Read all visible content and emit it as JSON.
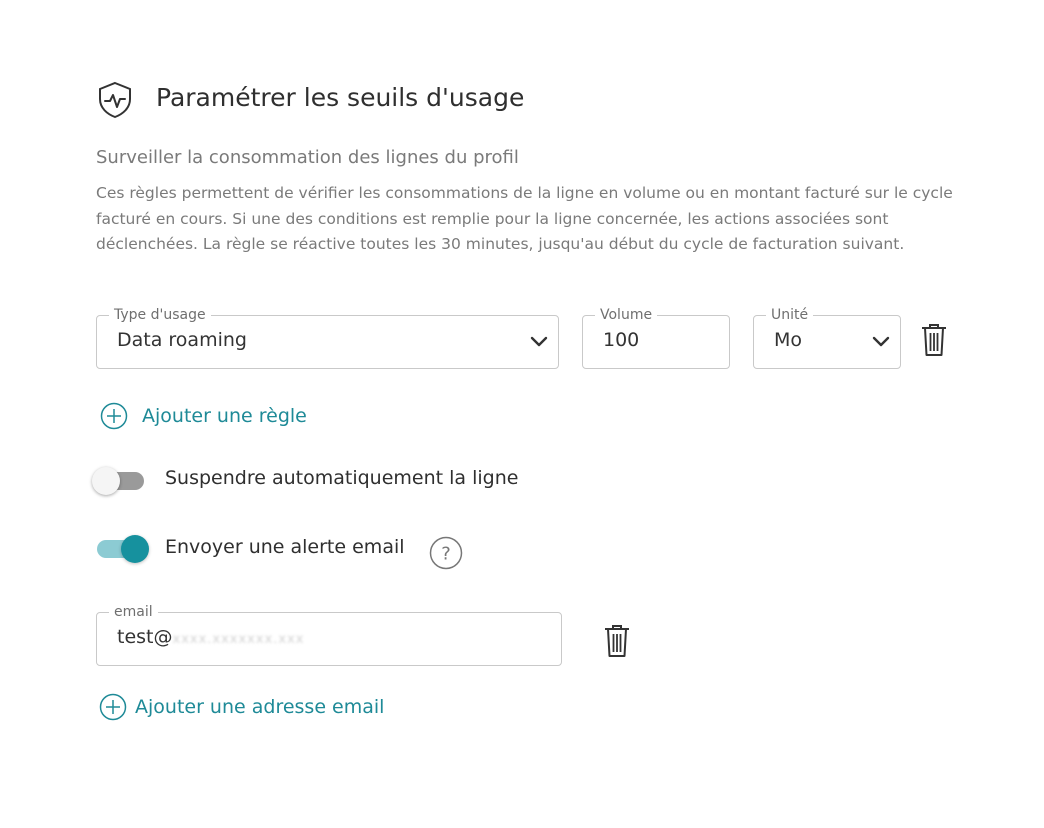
{
  "header": {
    "title": "Paramétrer les seuils d'usage",
    "icon": "shield-activity-icon"
  },
  "subtitle": "Surveiller la consommation des lignes du profil",
  "description": "Ces règles permettent de vérifier les consommations de la ligne en volume ou en montant facturé sur le cycle facturé en cours. Si une des conditions est remplie pour la ligne concernée, les actions associées sont déclenchées. La règle se réactive toutes les 30 minutes, jusqu'au début du cycle de facturation suivant.",
  "rule": {
    "usage_type_label": "Type d'usage",
    "usage_type_value": "Data roaming",
    "volume_label": "Volume",
    "volume_value": "100",
    "unit_label": "Unité",
    "unit_value": "Mo"
  },
  "add_rule_label": "Ajouter une règle",
  "suspend": {
    "label": "Suspendre automatiquement la ligne",
    "enabled": false
  },
  "email_alert": {
    "label": "Envoyer une alerte email",
    "enabled": true
  },
  "email_field": {
    "label": "email",
    "value_prefix": "test@",
    "value_obscured": "xxxx.xxxxxxx.xxx"
  },
  "add_email_label": "Ajouter une adresse email",
  "colors": {
    "accent": "#1e8a97",
    "toggle_on": "#16919e",
    "toggle_off": "#9a9a9a",
    "muted_text": "#7a7a7a"
  }
}
